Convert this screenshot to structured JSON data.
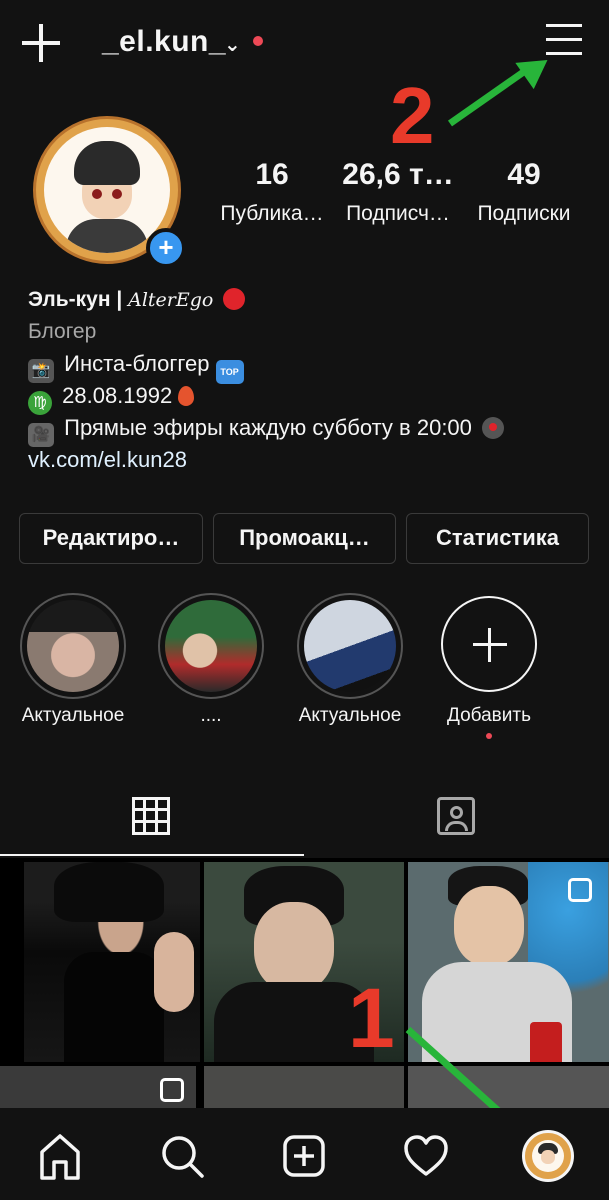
{
  "header": {
    "username": "_el.kun_",
    "chevron": "⌄"
  },
  "profile": {
    "stats": [
      {
        "value": "16",
        "label": "Публика…"
      },
      {
        "value": "26,6 т…",
        "label": "Подписч…"
      },
      {
        "value": "49",
        "label": "Подписки"
      }
    ],
    "add_story_icon": "+"
  },
  "bio": {
    "name": "Эль-кун |",
    "name_suffix": "AlterEgo",
    "category": "Блогер",
    "line1": "Инста-блоггер",
    "line1_badge": "TOP",
    "line2": "28.08.1992",
    "line3": "Прямые эфиры каждую субботу в 20:00",
    "link": "vk.com/el.kun28"
  },
  "buttons": {
    "edit": "Редактиро…",
    "promo": "Промоакц…",
    "stats": "Статистика"
  },
  "highlights": [
    {
      "label": "Актуальное"
    },
    {
      "label": "...."
    },
    {
      "label": "Актуальное"
    },
    {
      "label": "Добавить"
    }
  ],
  "annotations": {
    "marker_1": "1",
    "marker_2": "2",
    "arrow_color": "#28b53a",
    "marker_color": "#e83a2a"
  },
  "colors": {
    "background": "#121212",
    "accent_blue": "#3897f0",
    "notification_red": "#ed4956"
  },
  "icons": {
    "top_left": "plus-icon",
    "top_right": "menu-icon",
    "tab_active": "grid-icon",
    "tab_inactive": "tagged-icon",
    "bottom": [
      "home-icon",
      "search-icon",
      "new-post-icon",
      "activity-heart-icon",
      "profile-avatar-icon"
    ]
  }
}
